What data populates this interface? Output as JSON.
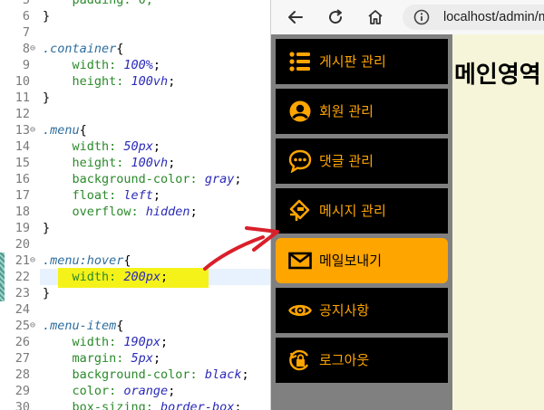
{
  "editor": {
    "lines": [
      {
        "num": "5",
        "fold": "",
        "parts": [
          {
            "t": "    padding: 0;",
            "c": "prop"
          }
        ]
      },
      {
        "num": "6",
        "fold": "",
        "parts": [
          {
            "t": "}",
            "c": "brace"
          }
        ]
      },
      {
        "num": "7",
        "fold": "",
        "parts": []
      },
      {
        "num": "8",
        "fold": "⊖",
        "parts": [
          {
            "t": ".container",
            "c": "sel"
          },
          {
            "t": "{",
            "c": "brace"
          }
        ]
      },
      {
        "num": "9",
        "fold": "",
        "parts": [
          {
            "t": "    width: ",
            "c": "prop"
          },
          {
            "t": "100%",
            "c": "val"
          },
          {
            "t": ";",
            "c": "brace"
          }
        ]
      },
      {
        "num": "10",
        "fold": "",
        "parts": [
          {
            "t": "    height: ",
            "c": "prop"
          },
          {
            "t": "100vh",
            "c": "val"
          },
          {
            "t": ";",
            "c": "brace"
          }
        ]
      },
      {
        "num": "11",
        "fold": "",
        "parts": [
          {
            "t": "}",
            "c": "brace"
          }
        ]
      },
      {
        "num": "12",
        "fold": "",
        "parts": []
      },
      {
        "num": "13",
        "fold": "⊖",
        "parts": [
          {
            "t": ".menu",
            "c": "sel"
          },
          {
            "t": "{",
            "c": "brace"
          }
        ]
      },
      {
        "num": "14",
        "fold": "",
        "parts": [
          {
            "t": "    width: ",
            "c": "prop"
          },
          {
            "t": "50px",
            "c": "val"
          },
          {
            "t": ";",
            "c": "brace"
          }
        ]
      },
      {
        "num": "15",
        "fold": "",
        "parts": [
          {
            "t": "    height: ",
            "c": "prop"
          },
          {
            "t": "100vh",
            "c": "val"
          },
          {
            "t": ";",
            "c": "brace"
          }
        ]
      },
      {
        "num": "16",
        "fold": "",
        "parts": [
          {
            "t": "    background-color: ",
            "c": "prop"
          },
          {
            "t": "gray",
            "c": "val"
          },
          {
            "t": ";",
            "c": "brace"
          }
        ]
      },
      {
        "num": "17",
        "fold": "",
        "parts": [
          {
            "t": "    float: ",
            "c": "prop"
          },
          {
            "t": "left",
            "c": "val"
          },
          {
            "t": ";",
            "c": "brace"
          }
        ]
      },
      {
        "num": "18",
        "fold": "",
        "parts": [
          {
            "t": "    overflow: ",
            "c": "prop"
          },
          {
            "t": "hidden",
            "c": "val"
          },
          {
            "t": ";",
            "c": "brace"
          }
        ]
      },
      {
        "num": "19",
        "fold": "",
        "parts": [
          {
            "t": "}",
            "c": "brace"
          }
        ]
      },
      {
        "num": "20",
        "fold": "",
        "parts": []
      },
      {
        "num": "21",
        "fold": "⊖",
        "parts": [
          {
            "t": ".menu:hover",
            "c": "sel"
          },
          {
            "t": "{",
            "c": "brace"
          }
        ]
      },
      {
        "num": "22",
        "fold": "",
        "parts": [
          {
            "t": "    width: ",
            "c": "prop"
          },
          {
            "t": "200px",
            "c": "val"
          },
          {
            "t": ";",
            "c": "brace"
          }
        ]
      },
      {
        "num": "23",
        "fold": "",
        "parts": [
          {
            "t": "}",
            "c": "brace"
          }
        ]
      },
      {
        "num": "24",
        "fold": "",
        "parts": []
      },
      {
        "num": "25",
        "fold": "⊖",
        "parts": [
          {
            "t": ".menu-item",
            "c": "sel"
          },
          {
            "t": "{",
            "c": "brace"
          }
        ]
      },
      {
        "num": "26",
        "fold": "",
        "parts": [
          {
            "t": "    width: ",
            "c": "prop"
          },
          {
            "t": "190px",
            "c": "val"
          },
          {
            "t": ";",
            "c": "brace"
          }
        ]
      },
      {
        "num": "27",
        "fold": "",
        "parts": [
          {
            "t": "    margin: ",
            "c": "prop"
          },
          {
            "t": "5px",
            "c": "val"
          },
          {
            "t": ";",
            "c": "brace"
          }
        ]
      },
      {
        "num": "28",
        "fold": "",
        "parts": [
          {
            "t": "    background-color: ",
            "c": "prop"
          },
          {
            "t": "black",
            "c": "val"
          },
          {
            "t": ";",
            "c": "brace"
          }
        ]
      },
      {
        "num": "29",
        "fold": "",
        "parts": [
          {
            "t": "    color: ",
            "c": "prop"
          },
          {
            "t": "orange",
            "c": "val"
          },
          {
            "t": ";",
            "c": "brace"
          }
        ]
      },
      {
        "num": "30",
        "fold": "",
        "parts": [
          {
            "t": "    box-sizing: ",
            "c": "prop"
          },
          {
            "t": "border-box",
            "c": "val"
          },
          {
            "t": ";",
            "c": "brace"
          }
        ]
      }
    ]
  },
  "browser": {
    "url": "localhost/admin/m",
    "icons": {
      "back": "back-arrow-icon",
      "reload": "reload-icon",
      "home": "home-icon",
      "info": "info-icon"
    }
  },
  "menu": {
    "items": [
      {
        "label": "게시판 관리",
        "icon": "list-icon",
        "active": false
      },
      {
        "label": "회원 관리",
        "icon": "user-circle-icon",
        "active": false
      },
      {
        "label": "댓글 관리",
        "icon": "comment-dots-icon",
        "active": false
      },
      {
        "label": "메시지 관리",
        "icon": "message-tag-icon",
        "active": false
      },
      {
        "label": "메일보내기",
        "icon": "envelope-icon",
        "active": true
      },
      {
        "label": "공지사항",
        "icon": "eye-icon",
        "active": false
      },
      {
        "label": "로그아웃",
        "icon": "logout-lock-icon",
        "active": false
      }
    ],
    "colors": {
      "background": "#808080",
      "item": "#000000",
      "text": "#ffa500",
      "active": "#ffa500"
    }
  },
  "main": {
    "title": "메인영역"
  },
  "annotation": {
    "highlight_color": "#f5f21a",
    "arrow_color": "#d9202a"
  }
}
